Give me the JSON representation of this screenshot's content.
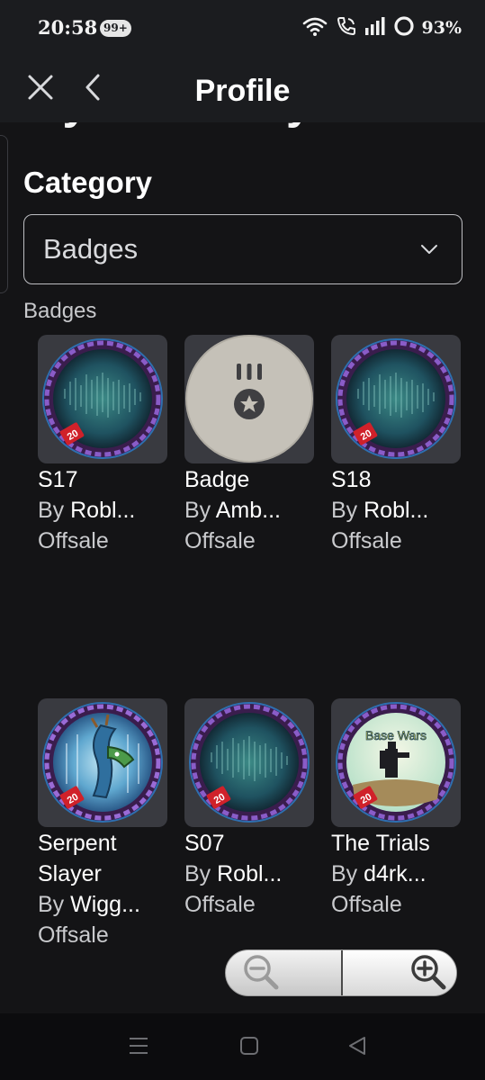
{
  "status_bar": {
    "time": "20:58",
    "notification_count": "99+",
    "battery": "93%",
    "icons": [
      "wifi-icon",
      "volte-call-icon",
      "signal-icon",
      "battery-ring-icon"
    ]
  },
  "header": {
    "title": "Profile",
    "close_icon": "close-icon",
    "back_icon": "back-chevron-icon"
  },
  "page": {
    "heading": "My Inventory",
    "category_label": "Category",
    "category_select": {
      "value": "Badges",
      "chevron_icon": "chevron-down-icon"
    },
    "section_label": "Badges"
  },
  "items": [
    {
      "name": "S17",
      "by_prefix": "By ",
      "creator": "Robl...",
      "status": "Offsale",
      "art": "season-badge"
    },
    {
      "name": "Badge",
      "by_prefix": "By ",
      "creator": "Amb...",
      "status": "Offsale",
      "art": "medal-badge"
    },
    {
      "name": "S18",
      "by_prefix": "By ",
      "creator": "Robl...",
      "status": "Offsale",
      "art": "season-badge"
    },
    {
      "name": "Serpent Slayer",
      "by_prefix": "By ",
      "creator": "Wigg...",
      "status": "Offsale",
      "art": "serpent-badge"
    },
    {
      "name": "S07",
      "by_prefix": "By ",
      "creator": "Robl...",
      "status": "Offsale",
      "art": "season-badge"
    },
    {
      "name": "The Trials",
      "by_prefix": "By ",
      "creator": "d4rk...",
      "status": "Offsale",
      "art": "base-wars-badge",
      "art_text": "Base Wars"
    }
  ],
  "badge_ribbon_number": "20",
  "zoom_control": {
    "zoom_out_icon": "zoom-out-icon",
    "zoom_in_icon": "zoom-in-icon"
  },
  "nav_bar": {
    "icons": [
      "menu-icon",
      "home-square-icon",
      "back-triangle-icon"
    ]
  },
  "colors": {
    "background": "#141416",
    "header_bg": "#1b1c1f",
    "card_bg": "#393a40",
    "text_primary": "#ffffff",
    "text_secondary": "#c9cacd"
  }
}
